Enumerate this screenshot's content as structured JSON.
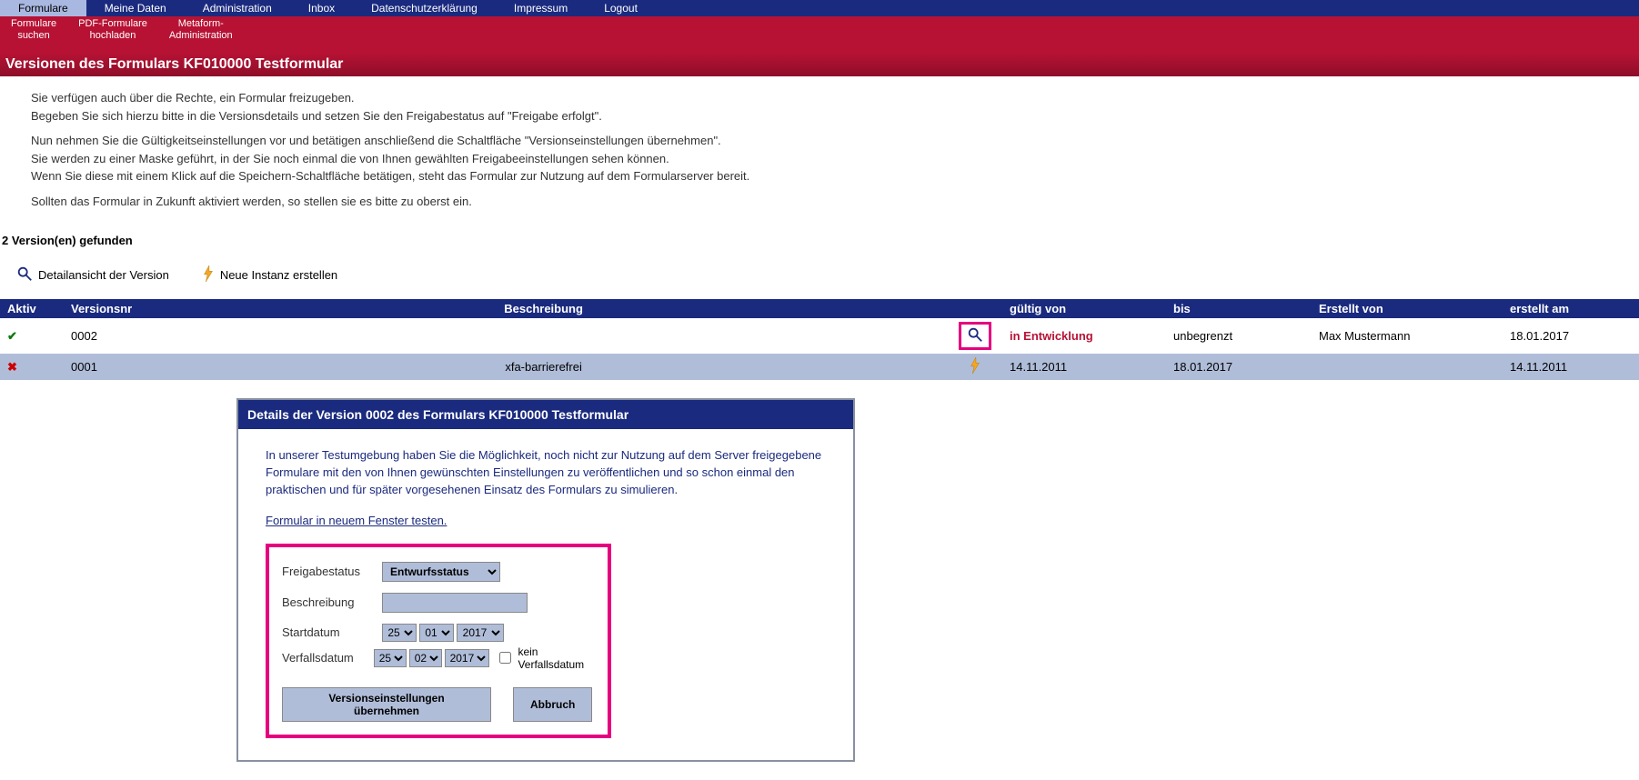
{
  "menu": {
    "top": [
      "Formulare",
      "Meine Daten",
      "Administration",
      "Inbox",
      "Datenschutzerklärung",
      "Impressum",
      "Logout"
    ],
    "sub": [
      "Formulare\nsuchen",
      "PDF-Formulare\nhochladen",
      "Metaform-\nAdministration"
    ]
  },
  "page_title": "Versionen des Formulars KF010000 Testformular",
  "intro": {
    "p1a": "Sie verfügen auch über die Rechte, ein Formular freizugeben.",
    "p1b": "Begeben Sie sich hierzu bitte in die Versionsdetails und setzen Sie den Freigabestatus auf \"Freigabe erfolgt\".",
    "p2a": "Nun nehmen Sie die Gültigkeitseinstellungen vor und betätigen anschließend die Schaltfläche \"Versionseinstellungen übernehmen\".",
    "p2b": "Sie werden zu einer Maske geführt, in der Sie noch einmal die von Ihnen gewählten Freigabeeinstellungen sehen können.",
    "p2c": "Wenn Sie diese mit einem Klick auf die Speichern-Schaltfläche betätigen, steht das Formular zur Nutzung auf dem Formularserver bereit.",
    "p3": "Sollten das Formular in Zukunft aktiviert werden, so stellen sie es bitte zu oberst ein."
  },
  "count_label": "2 Version(en) gefunden",
  "actions": {
    "detail": "Detailansicht der Version",
    "new_instance": "Neue Instanz erstellen"
  },
  "table": {
    "headers": {
      "aktiv": "Aktiv",
      "versnr": "Versionsnr",
      "beschr": "Beschreibung",
      "gueltig": "gültig von",
      "bis": "bis",
      "erst_von": "Erstellt von",
      "erst_am": "erstellt am"
    },
    "rows": [
      {
        "aktiv": true,
        "versnr": "0002",
        "beschr": "",
        "gueltig": "in Entwicklung",
        "gueltig_dev": true,
        "bis": "unbegrenzt",
        "erst_von": "Max Mustermann",
        "erst_am": "18.01.2017",
        "icon": "mag"
      },
      {
        "aktiv": false,
        "versnr": "0001",
        "beschr": "xfa-barrierefrei",
        "gueltig": "14.11.2011",
        "gueltig_dev": false,
        "bis": "18.01.2017",
        "erst_von": "",
        "erst_am": "14.11.2011",
        "icon": "bolt"
      }
    ]
  },
  "dialog": {
    "title_pre": "Details der Version",
    "title_ver": "0002",
    "title_post": "des Formulars KF010000 Testformular",
    "text": "In unserer Testumgebung haben Sie die Möglichkeit, noch nicht zur Nutzung auf dem Server freigegebene Formulare mit den von Ihnen gewünschten Einstellungen zu veröffentlichen und so schon einmal den praktischen und für später vorgesehenen Einsatz des Formulars zu simulieren.",
    "link": "Formular in neuem Fenster testen.",
    "form": {
      "freigabe_label": "Freigabestatus",
      "freigabe_value": "Entwurfsstatus",
      "beschr_label": "Beschreibung",
      "beschr_value": "",
      "start_label": "Startdatum",
      "start_d": "25",
      "start_m": "01",
      "start_y": "2017",
      "verfall_label": "Verfallsdatum",
      "verfall_d": "25",
      "verfall_m": "02",
      "verfall_y": "2017",
      "no_verfall_label": "kein Verfallsdatum",
      "btn_apply": "Versionseinstellungen übernehmen",
      "btn_cancel": "Abbruch"
    }
  }
}
